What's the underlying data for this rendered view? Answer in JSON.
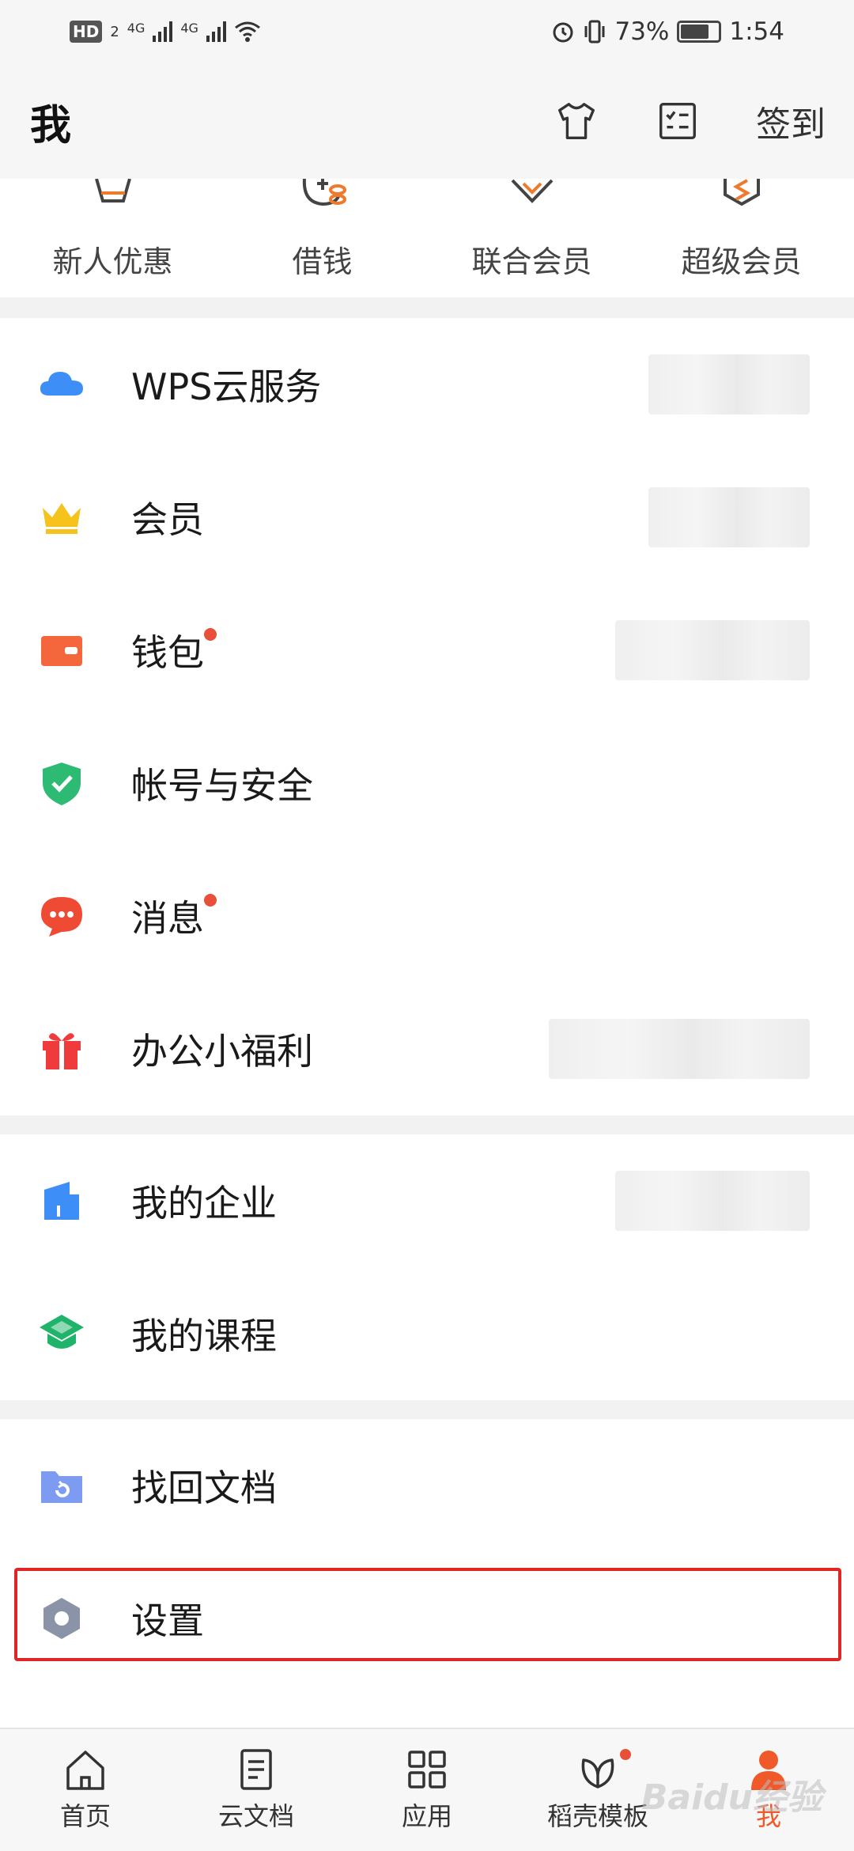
{
  "status_bar": {
    "hd_label": "HD",
    "hd_sub": "2",
    "net1": "4G",
    "net2": "4G",
    "battery_pct": "73%",
    "time": "1:54"
  },
  "header": {
    "title": "我",
    "signin_label": "签到",
    "icons": [
      "tshirt-icon",
      "checklist-icon"
    ]
  },
  "quick_entries": [
    {
      "label": "新人优惠",
      "icon": "gift-basket-icon"
    },
    {
      "label": "借钱",
      "icon": "loan-coin-icon"
    },
    {
      "label": "联合会员",
      "icon": "diamond-icon"
    },
    {
      "label": "超级会员",
      "icon": "s-shield-icon"
    }
  ],
  "sections": [
    {
      "items": [
        {
          "label": "WPS云服务",
          "icon": "cloud-icon",
          "icon_color": "#3e8ef7"
        },
        {
          "label": "会员",
          "icon": "crown-icon",
          "icon_color": "#f6c21c"
        },
        {
          "label": "钱包",
          "icon": "wallet-icon",
          "icon_color": "#f4663c",
          "has_dot": true
        },
        {
          "label": "帐号与安全",
          "icon": "shield-icon",
          "icon_color": "#2dbb74"
        },
        {
          "label": "消息",
          "icon": "chat-bubble-icon",
          "icon_color": "#ef4a34",
          "has_dot": true
        },
        {
          "label": "办公小福利",
          "icon": "gift-icon",
          "icon_color": "#ef3b3b"
        }
      ]
    },
    {
      "items": [
        {
          "label": "我的企业",
          "icon": "enterprise-icon",
          "icon_color": "#3e8ef7"
        },
        {
          "label": "我的课程",
          "icon": "graduation-cap-icon",
          "icon_color": "#1fb46a"
        }
      ]
    },
    {
      "items": [
        {
          "label": "找回文档",
          "icon": "recover-folder-icon",
          "icon_color": "#7d9bf0"
        },
        {
          "label": "设置",
          "icon": "settings-hex-icon",
          "icon_color": "#8a93a8"
        }
      ]
    }
  ],
  "bottom_nav": [
    {
      "label": "首页",
      "icon": "home-icon"
    },
    {
      "label": "云文档",
      "icon": "document-icon"
    },
    {
      "label": "应用",
      "icon": "apps-grid-icon"
    },
    {
      "label": "稻壳模板",
      "icon": "leaf-icon",
      "has_dot": true
    },
    {
      "label": "我",
      "icon": "person-icon",
      "active": true
    }
  ],
  "watermark": "Baidu经验",
  "colors": {
    "accent": "#f05a2a",
    "highlight_box": "#e02525",
    "page_bg": "#f2f2f2"
  }
}
